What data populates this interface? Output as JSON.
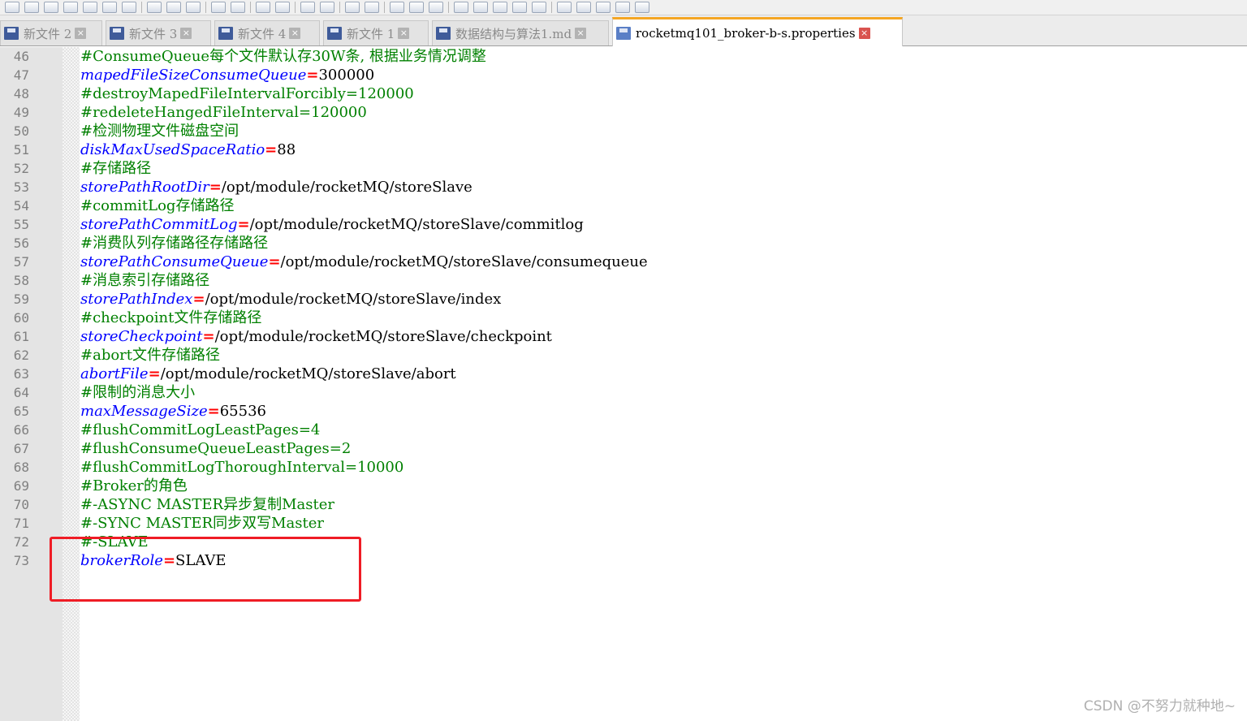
{
  "tabs": [
    {
      "label": "新文件 2",
      "active": false
    },
    {
      "label": "新文件 3",
      "active": false
    },
    {
      "label": "新文件 4",
      "active": false
    },
    {
      "label": "新文件 1",
      "active": false
    },
    {
      "label": "数据结构与算法1.md",
      "active": false
    },
    {
      "label": "rocketmq101_broker-b-s.properties",
      "active": true
    }
  ],
  "close_glyph": "×",
  "editor": {
    "lines": [
      {
        "n": "46",
        "comment": "#ConsumeQueue每个文件默认存30W条, 根据业务情况调整"
      },
      {
        "n": "47",
        "key": "mapedFileSizeConsumeQueue",
        "eq": "=",
        "value": "300000"
      },
      {
        "n": "48",
        "comment": "#destroyMapedFileIntervalForcibly=120000"
      },
      {
        "n": "49",
        "comment": "#redeleteHangedFileInterval=120000"
      },
      {
        "n": "50",
        "comment": "#检测物理文件磁盘空间"
      },
      {
        "n": "51",
        "key": "diskMaxUsedSpaceRatio",
        "eq": "=",
        "value": "88"
      },
      {
        "n": "52",
        "comment": "#存储路径"
      },
      {
        "n": "53",
        "key": "storePathRootDir",
        "eq": "=",
        "value": "/opt/module/rocketMQ/storeSlave"
      },
      {
        "n": "54",
        "comment": "#commitLog存储路径"
      },
      {
        "n": "55",
        "key": "storePathCommitLog",
        "eq": "=",
        "value": "/opt/module/rocketMQ/storeSlave/commitlog"
      },
      {
        "n": "56",
        "comment": "#消费队列存储路径存储路径"
      },
      {
        "n": "57",
        "key": "storePathConsumeQueue",
        "eq": "=",
        "value": "/opt/module/rocketMQ/storeSlave/consumequeue"
      },
      {
        "n": "58",
        "comment": "#消息索引存储路径"
      },
      {
        "n": "59",
        "key": "storePathIndex",
        "eq": "=",
        "value": "/opt/module/rocketMQ/storeSlave/index"
      },
      {
        "n": "60",
        "comment": "#checkpoint文件存储路径"
      },
      {
        "n": "61",
        "key": "storeCheckpoint",
        "eq": "=",
        "value": "/opt/module/rocketMQ/storeSlave/checkpoint"
      },
      {
        "n": "62",
        "comment": "#abort文件存储路径"
      },
      {
        "n": "63",
        "key": "abortFile",
        "eq": "=",
        "value": "/opt/module/rocketMQ/storeSlave/abort"
      },
      {
        "n": "64",
        "comment": "#限制的消息大小"
      },
      {
        "n": "65",
        "key": "maxMessageSize",
        "eq": "=",
        "value": "65536"
      },
      {
        "n": "66",
        "comment": "#flushCommitLogLeastPages=4"
      },
      {
        "n": "67",
        "comment": "#flushConsumeQueueLeastPages=2"
      },
      {
        "n": "68",
        "comment": "#flushCommitLogThoroughInterval=10000"
      },
      {
        "n": "69",
        "comment": "#Broker的角色"
      },
      {
        "n": "70",
        "comment": "#-ASYNC MASTER异步复制Master"
      },
      {
        "n": "71",
        "comment": "#-SYNC MASTER同步双写Master"
      },
      {
        "n": "72",
        "comment": "#-SLAVE"
      },
      {
        "n": "73",
        "key": "brokerRole",
        "eq": "=",
        "value": "SLAVE"
      }
    ]
  },
  "colors": {
    "comment": "#008000",
    "key": "#0000ff",
    "operator": "#ff0000",
    "highlight_box": "#ef1c25",
    "active_tab_accent": "#f5a623"
  },
  "watermark": "CSDN @不努力就种地~"
}
